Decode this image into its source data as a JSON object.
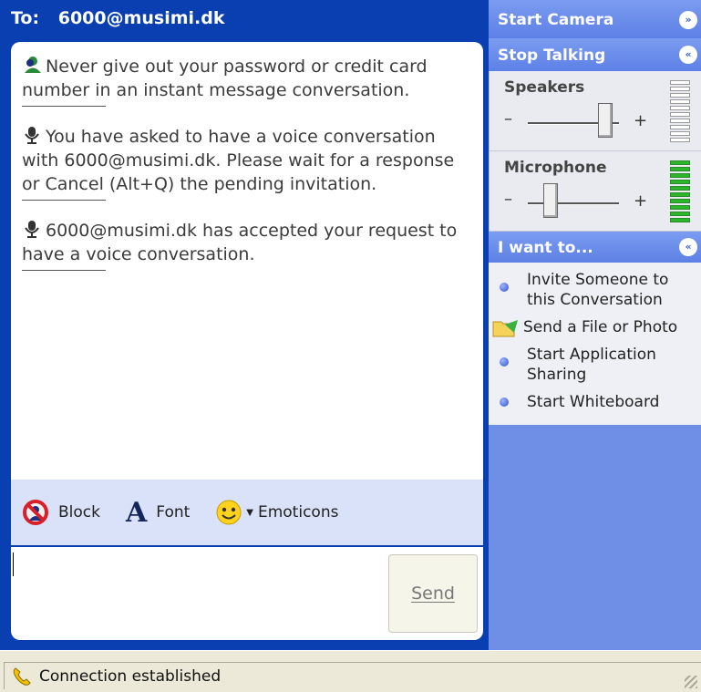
{
  "header": {
    "to_label": "To:",
    "contact": "6000@musimi.dk"
  },
  "messages": [
    {
      "icon": "buddy-icon",
      "text": "Never give out your password or credit card number in an instant message conversation."
    },
    {
      "icon": "microphone-icon",
      "text": "You have asked to have a voice conversation with 6000@musimi.dk. Please wait for a response or Cancel (Alt+Q) the pending invitation."
    },
    {
      "icon": "microphone-icon",
      "text": "6000@musimi.dk has accepted your request to have a voice conversation."
    }
  ],
  "toolbar": {
    "block_label": "Block",
    "font_letter": "A",
    "font_label": "Font",
    "emoticons_label": "Emoticons"
  },
  "input": {
    "value": "",
    "send_label": "Send"
  },
  "right_panel": {
    "start_camera": "Start Camera",
    "stop_talking": "Stop Talking",
    "speakers": {
      "label": "Speakers",
      "minus": "–",
      "plus": "+",
      "level_fraction": 0.85
    },
    "microphone": {
      "label": "Microphone",
      "minus": "–",
      "plus": "+",
      "level_fraction": 0.25
    },
    "i_want_to": "I want to...",
    "tasks": [
      {
        "label": "Invite Someone to this Conversation",
        "icon": "bullet-icon"
      },
      {
        "label": "Send a File or Photo",
        "icon": "folder-send-icon"
      },
      {
        "label": "Start Application Sharing",
        "icon": "bullet-icon"
      },
      {
        "label": "Start Whiteboard",
        "icon": "bullet-icon"
      }
    ]
  },
  "status": {
    "text": "Connection established"
  },
  "colors": {
    "title_blue": "#0a3fb1",
    "panel_blue": "#6f8fe6",
    "status_bg": "#ece9d8"
  }
}
